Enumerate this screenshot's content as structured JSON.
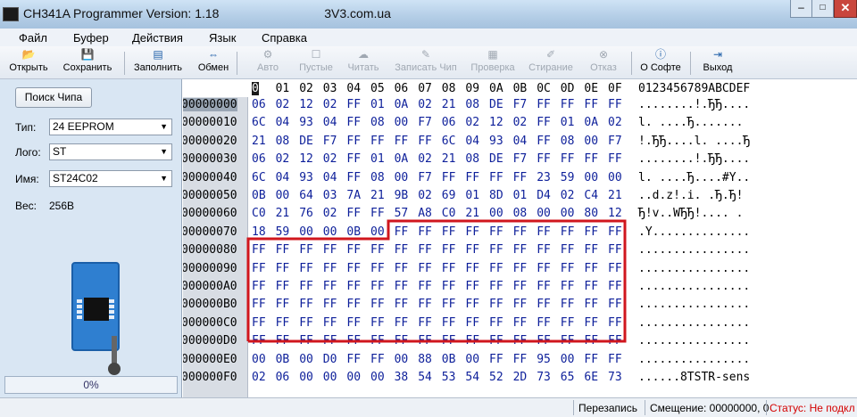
{
  "window": {
    "title": "CH341A Programmer Version: 1.18",
    "watermark": "3V3.com.ua",
    "minimize": "–",
    "maximize": "□",
    "close": "✕"
  },
  "menu": [
    "Файл",
    "Буфер",
    "Действия",
    "Язык",
    "Справка"
  ],
  "toolbar": [
    {
      "label": "Открыть",
      "icon": "folder-icon",
      "glyph": "📂",
      "enabled": true
    },
    {
      "label": "Сохранить",
      "icon": "save-icon",
      "glyph": "💾",
      "enabled": true
    },
    {
      "label": "Заполнить",
      "icon": "fill-icon",
      "glyph": "▤",
      "enabled": true
    },
    {
      "label": "Обмен",
      "icon": "swap-icon",
      "glyph": "⇔",
      "enabled": true
    },
    {
      "label": "Авто",
      "icon": "auto-icon",
      "glyph": "⚙",
      "enabled": false
    },
    {
      "label": "Пустые",
      "icon": "blank-icon",
      "glyph": "☐",
      "enabled": false
    },
    {
      "label": "Читать",
      "icon": "read-icon",
      "glyph": "☁",
      "enabled": false
    },
    {
      "label": "Записать Чип",
      "icon": "write-icon",
      "glyph": "✎",
      "enabled": false
    },
    {
      "label": "Проверка",
      "icon": "verify-icon",
      "glyph": "▦",
      "enabled": false
    },
    {
      "label": "Стирание",
      "icon": "erase-icon",
      "glyph": "✐",
      "enabled": false
    },
    {
      "label": "Отказ",
      "icon": "cancel-icon",
      "glyph": "⊗",
      "enabled": false
    },
    {
      "label": "О Софте",
      "icon": "info-icon",
      "glyph": "ⓘ",
      "enabled": true
    },
    {
      "label": "Выход",
      "icon": "exit-icon",
      "glyph": "⇥",
      "enabled": true
    }
  ],
  "left_panel": {
    "search_button": "Поиск Чипа",
    "type_label": "Тип:",
    "type_value": "24 EEPROM",
    "brand_label": "Лого:",
    "brand_value": "ST",
    "name_label": "Имя:",
    "name_value": "ST24C02",
    "size_label": "Вес:",
    "size_value": "256B",
    "progress": "0%",
    "progress_fraction": 0
  },
  "hex": {
    "cursor": "0",
    "header": [
      "0",
      "01",
      "02",
      "03",
      "04",
      "05",
      "06",
      "07",
      "08",
      "09",
      "0A",
      "0B",
      "0C",
      "0D",
      "0E",
      "0F"
    ],
    "ascii_header": "0123456789ABCDEF",
    "rows": [
      {
        "addr": "00000000",
        "bytes": [
          "06",
          "02",
          "12",
          "02",
          "FF",
          "01",
          "0A",
          "02",
          "21",
          "08",
          "DE",
          "F7",
          "FF",
          "FF",
          "FF",
          "FF"
        ],
        "ascii": "........!.ЂЂ...."
      },
      {
        "addr": "00000010",
        "bytes": [
          "6C",
          "04",
          "93",
          "04",
          "FF",
          "08",
          "00",
          "F7",
          "06",
          "02",
          "12",
          "02",
          "FF",
          "01",
          "0A",
          "02"
        ],
        "ascii": "l. ....Ђ......."
      },
      {
        "addr": "00000020",
        "bytes": [
          "21",
          "08",
          "DE",
          "F7",
          "FF",
          "FF",
          "FF",
          "FF",
          "6C",
          "04",
          "93",
          "04",
          "FF",
          "08",
          "00",
          "F7"
        ],
        "ascii": "!.ЂЂ....l. ....Ђ"
      },
      {
        "addr": "00000030",
        "bytes": [
          "06",
          "02",
          "12",
          "02",
          "FF",
          "01",
          "0A",
          "02",
          "21",
          "08",
          "DE",
          "F7",
          "FF",
          "FF",
          "FF",
          "FF"
        ],
        "ascii": "........!.ЂЂ...."
      },
      {
        "addr": "00000040",
        "bytes": [
          "6C",
          "04",
          "93",
          "04",
          "FF",
          "08",
          "00",
          "F7",
          "FF",
          "FF",
          "FF",
          "FF",
          "23",
          "59",
          "00",
          "00"
        ],
        "ascii": "l. ....Ђ....#Y.."
      },
      {
        "addr": "00000050",
        "bytes": [
          "0B",
          "00",
          "64",
          "03",
          "7A",
          "21",
          "9B",
          "02",
          "69",
          "01",
          "8D",
          "01",
          "D4",
          "02",
          "C4",
          "21"
        ],
        "ascii": "..d.z!.i. .Ђ.Ђ!"
      },
      {
        "addr": "00000060",
        "bytes": [
          "C0",
          "21",
          "76",
          "02",
          "FF",
          "FF",
          "57",
          "A8",
          "C0",
          "21",
          "00",
          "08",
          "00",
          "00",
          "80",
          "12"
        ],
        "ascii": "Ђ!v..WЂЂ!.... ."
      },
      {
        "addr": "00000070",
        "bytes": [
          "18",
          "59",
          "00",
          "00",
          "0B",
          "00",
          "FF",
          "FF",
          "FF",
          "FF",
          "FF",
          "FF",
          "FF",
          "FF",
          "FF",
          "FF"
        ],
        "ascii": ".Y.............."
      },
      {
        "addr": "00000080",
        "bytes": [
          "FF",
          "FF",
          "FF",
          "FF",
          "FF",
          "FF",
          "FF",
          "FF",
          "FF",
          "FF",
          "FF",
          "FF",
          "FF",
          "FF",
          "FF",
          "FF"
        ],
        "ascii": "................"
      },
      {
        "addr": "00000090",
        "bytes": [
          "FF",
          "FF",
          "FF",
          "FF",
          "FF",
          "FF",
          "FF",
          "FF",
          "FF",
          "FF",
          "FF",
          "FF",
          "FF",
          "FF",
          "FF",
          "FF"
        ],
        "ascii": "................"
      },
      {
        "addr": "000000A0",
        "bytes": [
          "FF",
          "FF",
          "FF",
          "FF",
          "FF",
          "FF",
          "FF",
          "FF",
          "FF",
          "FF",
          "FF",
          "FF",
          "FF",
          "FF",
          "FF",
          "FF"
        ],
        "ascii": "................"
      },
      {
        "addr": "000000B0",
        "bytes": [
          "FF",
          "FF",
          "FF",
          "FF",
          "FF",
          "FF",
          "FF",
          "FF",
          "FF",
          "FF",
          "FF",
          "FF",
          "FF",
          "FF",
          "FF",
          "FF"
        ],
        "ascii": "................"
      },
      {
        "addr": "000000C0",
        "bytes": [
          "FF",
          "FF",
          "FF",
          "FF",
          "FF",
          "FF",
          "FF",
          "FF",
          "FF",
          "FF",
          "FF",
          "FF",
          "FF",
          "FF",
          "FF",
          "FF"
        ],
        "ascii": "................"
      },
      {
        "addr": "000000D0",
        "bytes": [
          "FF",
          "FF",
          "FF",
          "FF",
          "FF",
          "FF",
          "FF",
          "FF",
          "FF",
          "FF",
          "FF",
          "FF",
          "FF",
          "FF",
          "FF",
          "FF"
        ],
        "ascii": "................"
      },
      {
        "addr": "000000E0",
        "bytes": [
          "00",
          "0B",
          "00",
          "D0",
          "FF",
          "FF",
          "00",
          "88",
          "0B",
          "00",
          "FF",
          "FF",
          "95",
          "00",
          "FF",
          "FF"
        ],
        "ascii": "................"
      },
      {
        "addr": "000000F0",
        "bytes": [
          "02",
          "06",
          "00",
          "00",
          "00",
          "00",
          "38",
          "54",
          "53",
          "54",
          "52",
          "2D",
          "73",
          "65",
          "6E",
          "73"
        ],
        "ascii": "......8TSTR-sens"
      }
    ],
    "highlight_color": "#d0161d"
  },
  "status": {
    "mode": "Перезапись",
    "offset": "Смещение: 00000000, 0",
    "status": "Статус: Не подкл",
    "status_color": "#d40000"
  }
}
